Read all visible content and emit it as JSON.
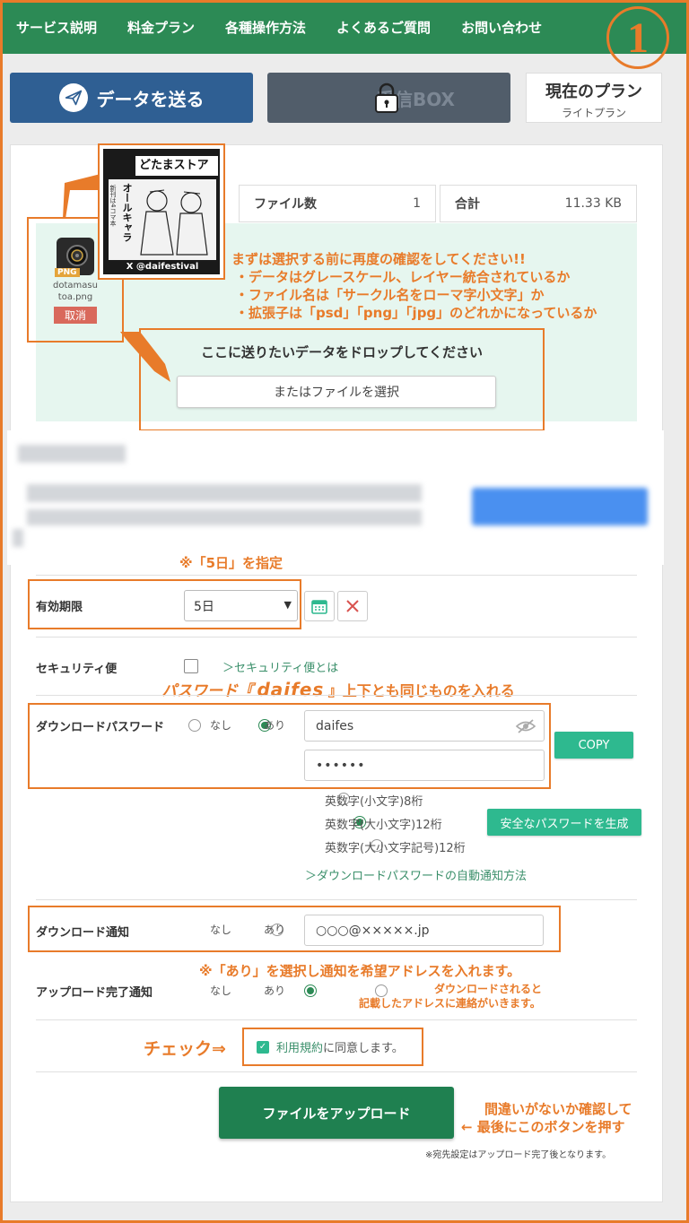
{
  "nav": {
    "items": [
      "サービス説明",
      "料金プラン",
      "各種操作方法",
      "よくあるご質問",
      "お問い合わせ"
    ]
  },
  "step_number": "1",
  "toolbar": {
    "send_label": "データを送る",
    "box_label": "受信BOX",
    "plan_title": "現在のプラン",
    "plan_name": "ライトプラン"
  },
  "stats": {
    "file_count_label": "ファイル数",
    "file_count": "1",
    "total_label": "合計",
    "total_size": "11.33 KB"
  },
  "file": {
    "name": "dotamasutoa.png",
    "name_line1": "dotamasu",
    "name_line2": "toa.png",
    "badge": "PNG",
    "cancel_label": "取消",
    "thumb_banner": "どたまストア",
    "thumb_title": "オールキャラ",
    "thumb_vertical": "新刊は4コマ本",
    "thumb_footer": "X @daifestival"
  },
  "drop": {
    "prompt": "ここに送りたいデータをドロップしてください",
    "select_label": "またはファイルを選択"
  },
  "annotations": {
    "check_title": "まずは選択する前に再度の確認をしてください!!",
    "check_1": "・データはグレースケール、レイヤー統合されているか",
    "check_2": "・ファイル名は「サークル名をローマ字小文字」か",
    "check_3": "・拡張子は「psd」「png」「jpg」のどれかになっているか",
    "expiry_note": "※「5日」を指定",
    "password_note_a": "パスワード『",
    "password_note_b": "daifes",
    "password_note_c": "』上下とも同じものを入れる",
    "notify_note": "※「あり」を選択し通知を希望アドレスを入れます。",
    "upload_note_1": "ダウンロードされると",
    "upload_note_2": "記載したアドレスに連絡がいきます。",
    "check_note": "チェック⇒",
    "final_note_1": "間違いがないか確認して",
    "final_note_2": "← 最後にこのボタンを押す"
  },
  "form": {
    "expiry_label": "有効期限",
    "expiry_value": "5日",
    "security_label": "セキュリティ便",
    "security_link": "＞セキュリティ便とは",
    "password_label": "ダウンロードパスワード",
    "opt_none": "なし",
    "opt_yes": "あり",
    "password_value": "daifes",
    "password_masked": "••••••",
    "copy_label": "COPY",
    "pw_opt_1": "英数字(小文字)8桁",
    "pw_opt_2": "英数字(大小文字)12桁",
    "pw_opt_3": "英数字(大小文字記号)12桁",
    "generate_label": "安全なパスワードを生成",
    "auto_notify_link": "＞ダウンロードパスワードの自動通知方法",
    "dl_notify_label": "ダウンロード通知",
    "dl_notify_email": "○○○@×××××.jp",
    "upload_notify_label": "アップロード完了通知",
    "terms_link": "利用規約",
    "terms_text": "に同意します。",
    "upload_label": "ファイルをアップロード",
    "footnote": "※宛先設定はアップロード完了後となります。"
  },
  "colors": {
    "nav_green": "#2c8a55",
    "send_blue": "#2f5f93",
    "annotation_orange": "#e87b2a",
    "upload_green": "#1f8050",
    "accent_teal": "#2eb98f"
  }
}
